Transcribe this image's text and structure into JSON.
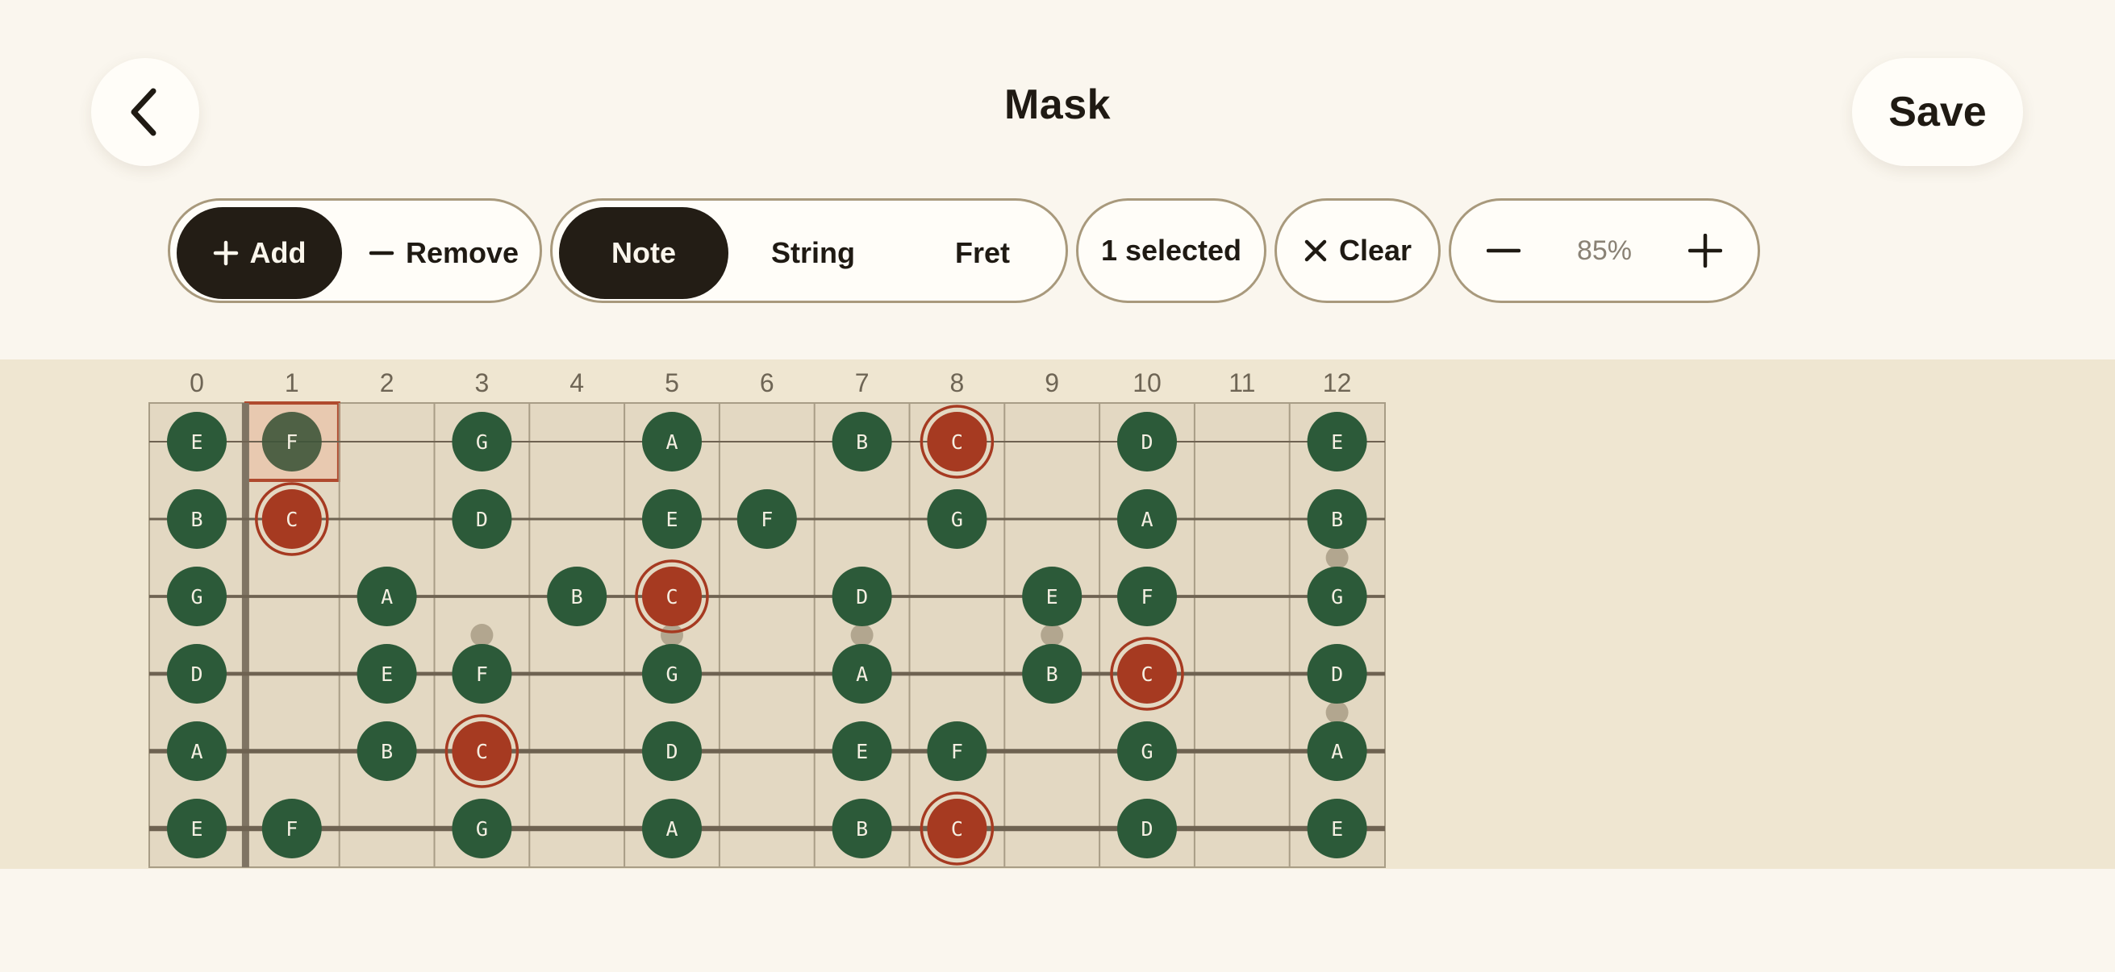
{
  "header": {
    "title": "Mask",
    "save_label": "Save"
  },
  "toolbar": {
    "add_label": "Add",
    "remove_label": "Remove",
    "mode_active": "add",
    "selection_modes": [
      "Note",
      "String",
      "Fret"
    ],
    "selection_active": "Note",
    "selected_label": "1 selected",
    "clear_label": "Clear",
    "zoom_label": "85%"
  },
  "colors": {
    "note_green": "#2c5a39",
    "note_masked": "#a63a21",
    "masked_ring": "#a63a21",
    "selection_border": "#b04a2e",
    "selection_fill": "#e8c9b0",
    "fret_bg": "#e3d8c2",
    "board_bg": "#efe6d1",
    "page_bg": "#faf6ee",
    "active_segment": "#231d15"
  },
  "fretboard": {
    "fret_numbers": [
      "0",
      "1",
      "2",
      "3",
      "4",
      "5",
      "6",
      "7",
      "8",
      "9",
      "10",
      "11",
      "12"
    ],
    "inlay_frets": [
      3,
      5,
      7,
      9,
      12
    ],
    "selected_cell": {
      "string": 0,
      "fret": 1
    },
    "strings": [
      {
        "notes": [
          {
            "fret": 0,
            "note": "E"
          },
          {
            "fret": 1,
            "note": "F"
          },
          {
            "fret": 3,
            "note": "G"
          },
          {
            "fret": 5,
            "note": "A"
          },
          {
            "fret": 7,
            "note": "B"
          },
          {
            "fret": 8,
            "note": "C",
            "masked": true
          },
          {
            "fret": 10,
            "note": "D"
          },
          {
            "fret": 12,
            "note": "E"
          }
        ]
      },
      {
        "notes": [
          {
            "fret": 0,
            "note": "B"
          },
          {
            "fret": 1,
            "note": "C",
            "masked": true
          },
          {
            "fret": 3,
            "note": "D"
          },
          {
            "fret": 5,
            "note": "E"
          },
          {
            "fret": 6,
            "note": "F"
          },
          {
            "fret": 8,
            "note": "G"
          },
          {
            "fret": 10,
            "note": "A"
          },
          {
            "fret": 12,
            "note": "B"
          }
        ]
      },
      {
        "notes": [
          {
            "fret": 0,
            "note": "G"
          },
          {
            "fret": 2,
            "note": "A"
          },
          {
            "fret": 4,
            "note": "B"
          },
          {
            "fret": 5,
            "note": "C",
            "masked": true
          },
          {
            "fret": 7,
            "note": "D"
          },
          {
            "fret": 9,
            "note": "E"
          },
          {
            "fret": 10,
            "note": "F"
          },
          {
            "fret": 12,
            "note": "G"
          }
        ]
      },
      {
        "notes": [
          {
            "fret": 0,
            "note": "D"
          },
          {
            "fret": 2,
            "note": "E"
          },
          {
            "fret": 3,
            "note": "F"
          },
          {
            "fret": 5,
            "note": "G"
          },
          {
            "fret": 7,
            "note": "A"
          },
          {
            "fret": 9,
            "note": "B"
          },
          {
            "fret": 10,
            "note": "C",
            "masked": true
          },
          {
            "fret": 12,
            "note": "D"
          }
        ]
      },
      {
        "notes": [
          {
            "fret": 0,
            "note": "A"
          },
          {
            "fret": 2,
            "note": "B"
          },
          {
            "fret": 3,
            "note": "C",
            "masked": true
          },
          {
            "fret": 5,
            "note": "D"
          },
          {
            "fret": 7,
            "note": "E"
          },
          {
            "fret": 8,
            "note": "F"
          },
          {
            "fret": 10,
            "note": "G"
          },
          {
            "fret": 12,
            "note": "A"
          }
        ]
      },
      {
        "notes": [
          {
            "fret": 0,
            "note": "E"
          },
          {
            "fret": 1,
            "note": "F"
          },
          {
            "fret": 3,
            "note": "G"
          },
          {
            "fret": 5,
            "note": "A"
          },
          {
            "fret": 7,
            "note": "B"
          },
          {
            "fret": 8,
            "note": "C",
            "masked": true
          },
          {
            "fret": 10,
            "note": "D"
          },
          {
            "fret": 12,
            "note": "E"
          }
        ]
      }
    ]
  }
}
